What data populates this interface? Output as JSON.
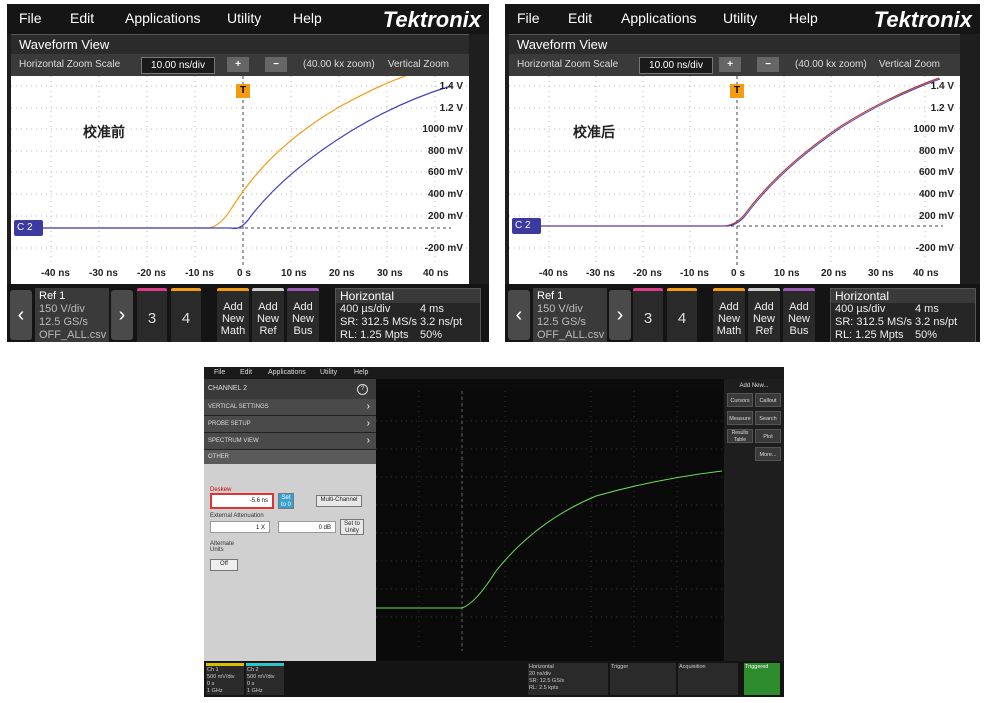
{
  "menu": [
    "File",
    "Edit",
    "Applications",
    "Utility",
    "Help"
  ],
  "brand": "Tektronix",
  "window_title": "Waveform View",
  "zoom": {
    "label": "Horizontal Zoom Scale",
    "value": "10.00 ns/div",
    "plus": "+",
    "minus": "−",
    "zoom_factor": "(40.00 kx zoom)",
    "vertical": "Vertical Zoom"
  },
  "y_labels": [
    "1.4 V",
    "1.2 V",
    "1000 mV",
    "800 mV",
    "600 mV",
    "400 mV",
    "200 mV",
    "-200 mV"
  ],
  "x_labels": [
    "-40 ns",
    "-30 ns",
    "-20 ns",
    "-10 ns",
    "0 s",
    "10 ns",
    "20 ns",
    "30 ns",
    "40 ns"
  ],
  "channel_label": "C 2",
  "trigger_label": "T",
  "panels": [
    {
      "annotation": "校准前"
    },
    {
      "annotation": "校准后"
    }
  ],
  "bottom": {
    "ref_title": "Ref 1",
    "ref_lines": [
      "150 V/div",
      "12.5 GS/s",
      "OFF_ALL.csv"
    ],
    "ch3": "3",
    "ch4": "4",
    "add_math": [
      "Add",
      "New",
      "Math"
    ],
    "add_ref": [
      "Add",
      "New",
      "Ref"
    ],
    "add_bus": [
      "Add",
      "New",
      "Bus"
    ],
    "horizontal": {
      "title": "Horizontal",
      "r1a": "400 µs/div",
      "r1b": "4 ms",
      "r2a": "SR: 312.5 MS/s",
      "r2b": "3.2 ns/pt",
      "r3a": "RL: 1.25 Mpts",
      "r3b": "50%"
    }
  },
  "s3": {
    "menu": [
      "File",
      "Edit",
      "Applications",
      "Utility",
      "Help"
    ],
    "panel_title": "CHANNEL 2",
    "rows": [
      "VERTICAL SETTINGS",
      "PROBE SETUP",
      "SPECTRUM VIEW"
    ],
    "other": "OTHER",
    "deskew_label": "Deskew",
    "deskew_value": "-5.6 ns",
    "set_to_0": "Set to 0",
    "multi_channel": "Multi-Channel",
    "ext_att_label": "External Attenuation",
    "ext_att_x": "1 X",
    "ext_att_db": "0 dB",
    "set_to_unity": "Set to Unity",
    "alt_units": "Alternate Units",
    "off": "Off",
    "side_title": "Add New...",
    "side_buttons": [
      "Cursors",
      "Callout",
      "Measure",
      "Search",
      "Results Table",
      "Plot",
      "More..."
    ],
    "ch1": "Ch 1",
    "ch1_lines": [
      "500 mV/div",
      "0 s",
      "1 GHz"
    ],
    "ch2": "Ch 2",
    "ch2_lines": [
      "500 mV/div",
      "0 s",
      "1 GHz"
    ],
    "horizontal": [
      "Horizontal",
      "20 ns/div",
      "SR: 12.5 GS/s",
      "RL: 2.5 kpts"
    ],
    "trigger": "Trigger",
    "acquisition": "Acquisition",
    "triggered": "Triggered"
  },
  "colors": {
    "ch_orange": "#f39c12",
    "ch_blue": "#4040c0",
    "trace_red": "#c0392b",
    "trace_green": "#6ddc5a"
  }
}
